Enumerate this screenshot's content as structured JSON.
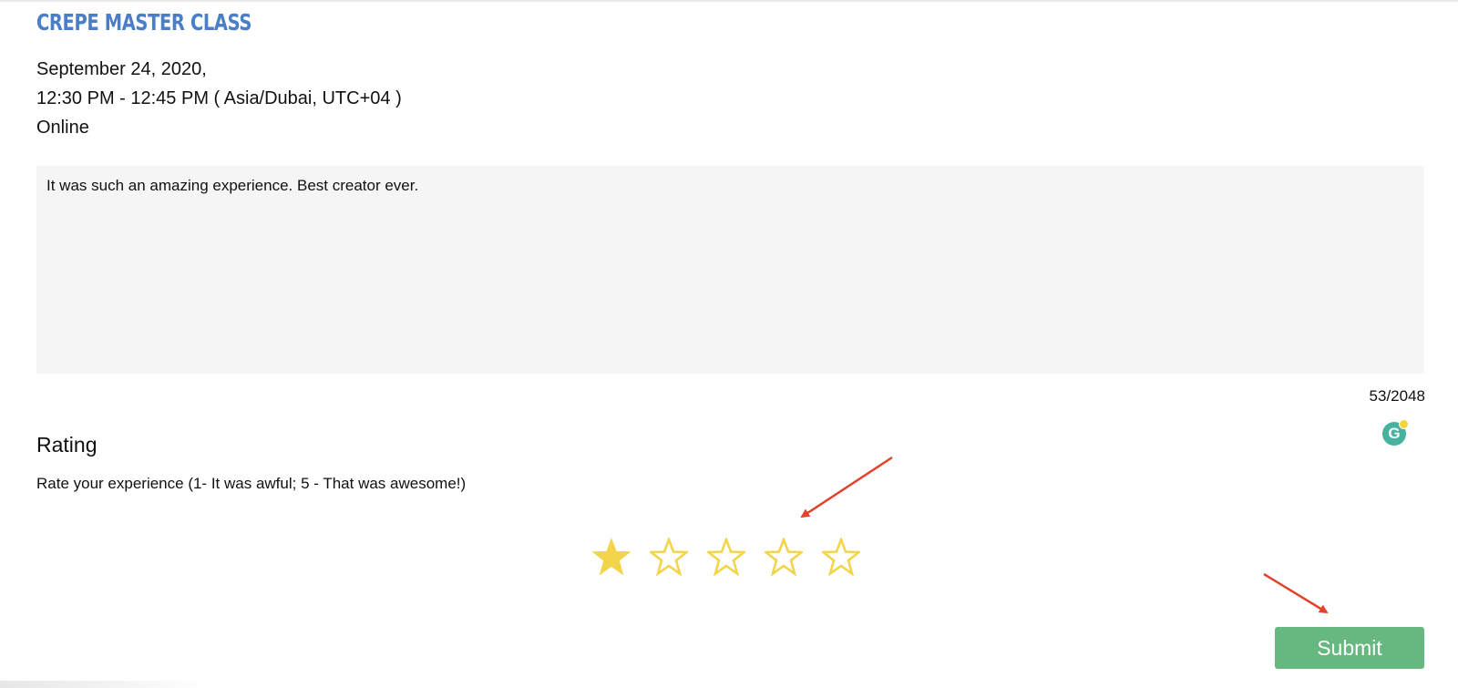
{
  "event": {
    "title": "Crepe Master Class",
    "date": "September 24, 2020,",
    "time": "12:30 PM - 12:45 PM ( Asia/Dubai, UTC+04 )",
    "location": "Online"
  },
  "review": {
    "text": "It was such an amazing experience. Best creator ever.",
    "counter": "53/2048"
  },
  "grammarly": {
    "letter": "G"
  },
  "rating": {
    "heading": "Rating",
    "description": "Rate your experience (1- It was awful; 5 - That was awesome!)",
    "value": 1,
    "max": 5,
    "star_color": "#f2d54a"
  },
  "submit": {
    "label": "Submit",
    "color": "#67b780"
  },
  "annotations": {
    "arrow_color": "#e0442c"
  }
}
